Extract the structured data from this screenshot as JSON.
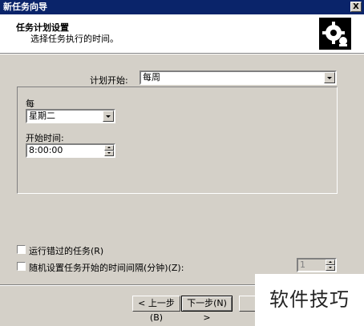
{
  "window": {
    "title": "新任务向导",
    "close_label": "X"
  },
  "header": {
    "title": "任务计划设置",
    "subtitle": "选择任务执行的时间。"
  },
  "schedule": {
    "label": "计划开始:",
    "value": "每周"
  },
  "group": {
    "every_label": "每",
    "day_value": "星期二",
    "start_time_label": "开始时间:",
    "start_time_value": "8:00:00"
  },
  "options": {
    "run_missed_label": "运行错过的任务(R)",
    "random_delay_label": "随机设置任务开始的时间间隔(分钟)(Z):",
    "random_delay_value": "1"
  },
  "buttons": {
    "back": "< 上一步(B)",
    "next": "下一步(N) >",
    "cancel": ""
  },
  "watermark": {
    "text": "软件技巧"
  }
}
